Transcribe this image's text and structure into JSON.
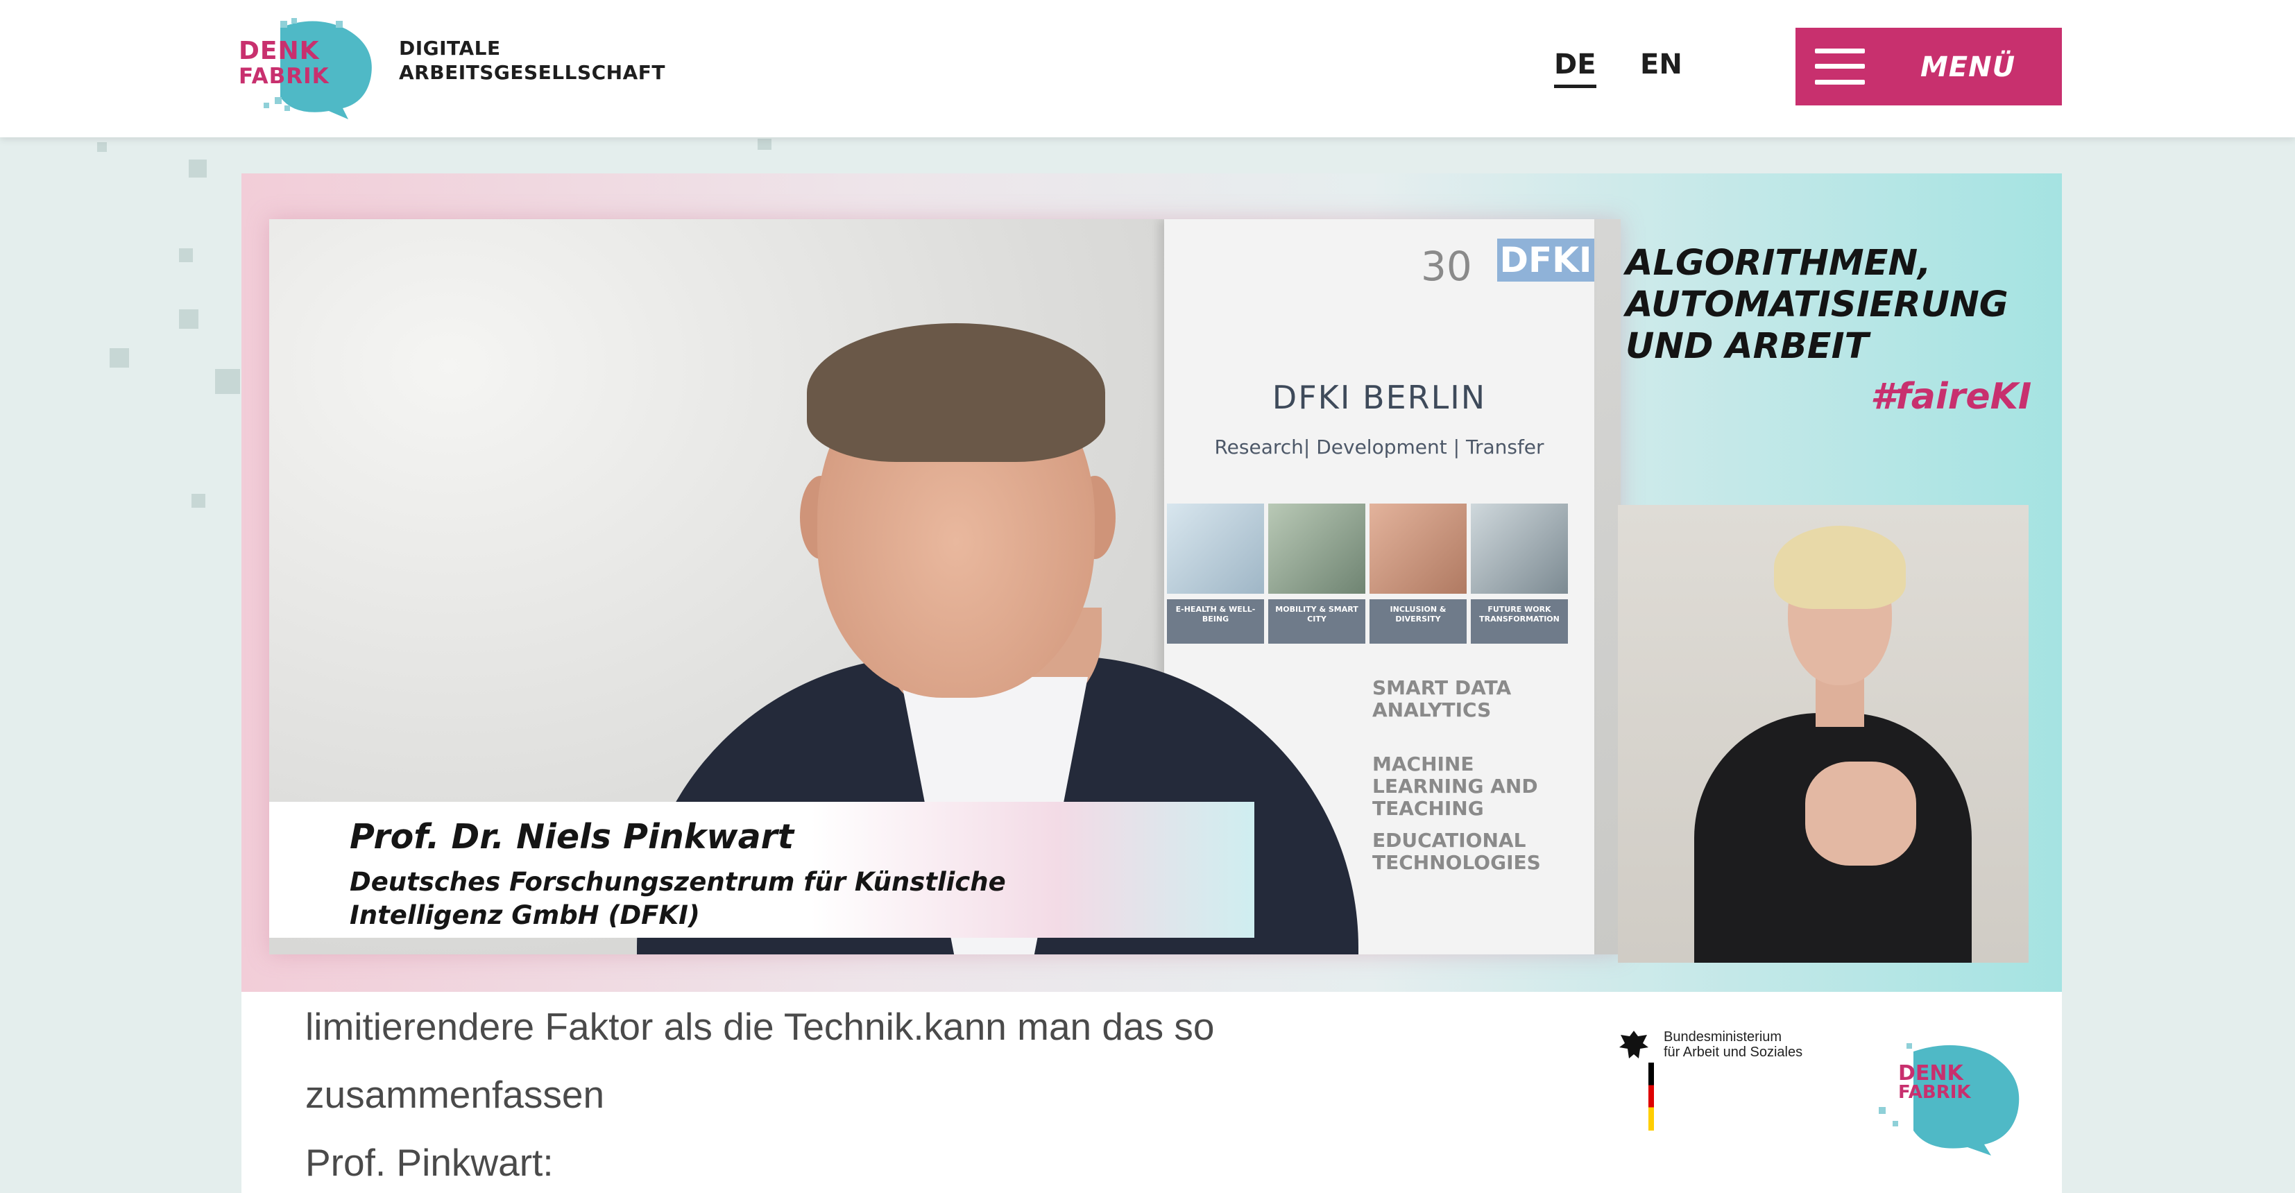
{
  "header": {
    "logo_line1": "DENK",
    "logo_line2": "FABRIK",
    "site_title_line1": "DIGITALE",
    "site_title_line2": "ARBEITSGESELLSCHAFT",
    "lang_de": "DE",
    "lang_en": "EN",
    "menu_label": "MENÜ"
  },
  "video": {
    "banner": {
      "logo_number": "30",
      "logo_text": "DFKI",
      "title": "DFKI BERLIN",
      "subtitle": "Research| Development | Transfer",
      "tiles": [
        {
          "label": "E-HEALTH & WELL-BEING"
        },
        {
          "label": "MOBILITY & SMART CITY"
        },
        {
          "label": "INCLUSION & DIVERSITY"
        },
        {
          "label": "FUTURE WORK TRANSFORMATION"
        }
      ],
      "items": [
        "SMART DATA ANALYTICS",
        "MACHINE LEARNING AND TEACHING",
        "EDUCATIONAL TECHNOLOGIES"
      ]
    },
    "lower_third": {
      "name": "Prof. Dr. Niels Pinkwart",
      "org_line1": "Deutsches Forschungszentrum für Künstliche",
      "org_line2": "Intelligenz GmbH (DFKI)"
    },
    "headline": [
      "ALGORITHMEN,",
      "AUTOMATISIERUNG",
      "UND ARBEIT"
    ],
    "hashtag": "#faireKI",
    "captions": [
      "limitierendere Faktor als die Technik.kann man das so",
      "zusammenfassen",
      "Prof. Pinkwart:"
    ],
    "ministry_line1": "Bundesministerium",
    "ministry_line2": "für Arbeit und Soziales",
    "footer_logo_line1": "DENK",
    "footer_logo_line2": "FABRIK"
  },
  "colors": {
    "brand_magenta": "#c8306e",
    "brand_teal": "#4fb9c6",
    "text_dark": "#1e1e1e",
    "page_bg": "#e4eeed"
  }
}
